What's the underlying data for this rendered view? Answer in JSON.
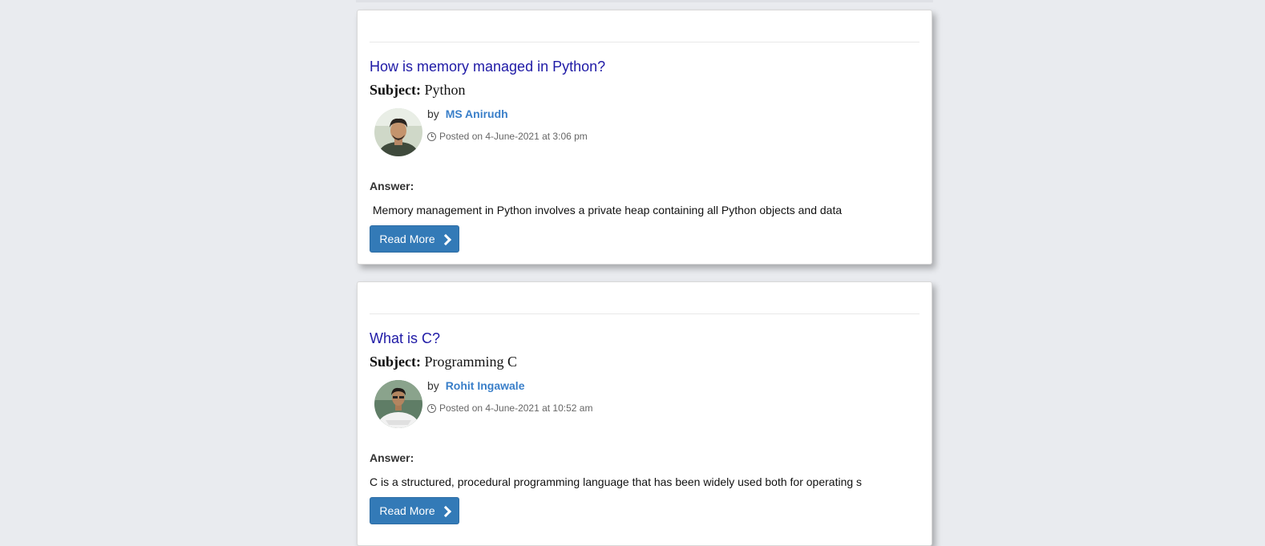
{
  "posts": [
    {
      "title": "How is memory managed in Python?",
      "subject_label": "Subject:",
      "subject": "Python",
      "by_label": "by",
      "author": "MS Anirudh",
      "posted": "Posted on 4-June-2021 at 3:06 pm",
      "answer_label": "Answer:",
      "answer": " Memory management in Python involves a private heap containing all Python objects and data",
      "read_more": "Read More",
      "icons": {
        "clock": "clock-icon",
        "chevron": "chevron-right-icon"
      }
    },
    {
      "title": "What is C?",
      "subject_label": "Subject:",
      "subject": "Programming C",
      "by_label": "by",
      "author": "Rohit Ingawale",
      "posted": "Posted on 4-June-2021 at 10:52 am",
      "answer_label": "Answer:",
      "answer": "C is a structured, procedural programming language that has been widely used both for operating s",
      "read_more": "Read More",
      "icons": {
        "clock": "clock-icon",
        "chevron": "chevron-right-icon"
      }
    }
  ],
  "colors": {
    "background": "#e9ebef",
    "title_link": "#1f1aa6",
    "author_link": "#3a7fc9",
    "button": "#337ab7"
  }
}
